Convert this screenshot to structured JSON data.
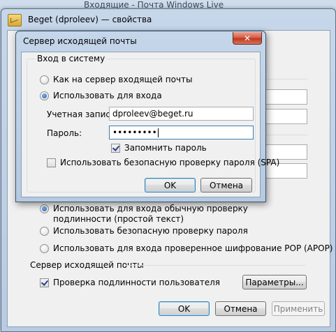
{
  "background": {
    "title": "Входящие - Почта Windows Live"
  },
  "back_window": {
    "title": "Beget (dproleev) — свойства",
    "auth_options": [
      {
        "label": "Использовать для входа обычную проверку подлинности (простой текст)",
        "checked": true
      },
      {
        "label": "Использовать безопасную проверку пароля",
        "checked": false
      },
      {
        "label": "Использовать для входа проверенное шифрование POP (APOP)",
        "checked": false
      }
    ],
    "outgoing_section_label": "Сервер исходящей почты",
    "auth_checkbox_label": "Проверка подлинности пользователя",
    "auth_checkbox_checked": true,
    "params_button": "Параметры...",
    "ok_button": "OK",
    "cancel_button": "Отмена",
    "apply_button": "Применить"
  },
  "dialog": {
    "title": "Сервер исходящей почты",
    "close_icon": "close-icon",
    "group_label": "Вход в систему",
    "radio_incoming": "Как на сервер входящей почты",
    "radio_use": "Использовать для входа",
    "radio_use_checked": true,
    "account_label": "Учетная запись:",
    "account_value": "dproleev@beget.ru",
    "password_label": "Пароль:",
    "password_value": "•••••••••",
    "remember_label": "Запомнить пароль",
    "remember_checked": true,
    "spa_label": "Использовать безопасную проверку пароля (SPA)",
    "spa_checked": false,
    "ok_button": "OK",
    "cancel_button": "Отмена"
  }
}
